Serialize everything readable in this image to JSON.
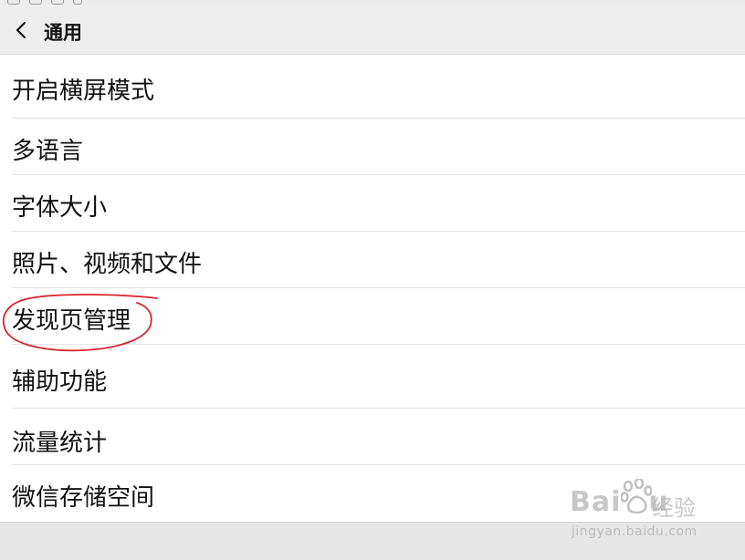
{
  "header": {
    "title": "通用"
  },
  "settings_items": [
    {
      "label": "开启横屏模式"
    },
    {
      "label": "多语言"
    },
    {
      "label": "字体大小"
    },
    {
      "label": "照片、视频和文件"
    },
    {
      "label": "发现页管理",
      "annotated": true
    },
    {
      "label": "辅助功能"
    },
    {
      "label": "流量统计"
    },
    {
      "label": "微信存储空间"
    }
  ],
  "watermark": {
    "brand_latin": "Bai",
    "brand_latin2": "u",
    "brand_cn": "经验",
    "url": "jingyan.baidu.com"
  },
  "colors": {
    "header_bg": "#ededed",
    "list_bg": "#ffffff",
    "annotation_red": "#d9232a"
  },
  "icons": {
    "back": "chevron-left-icon",
    "watermark_logo": "paw-icon"
  }
}
